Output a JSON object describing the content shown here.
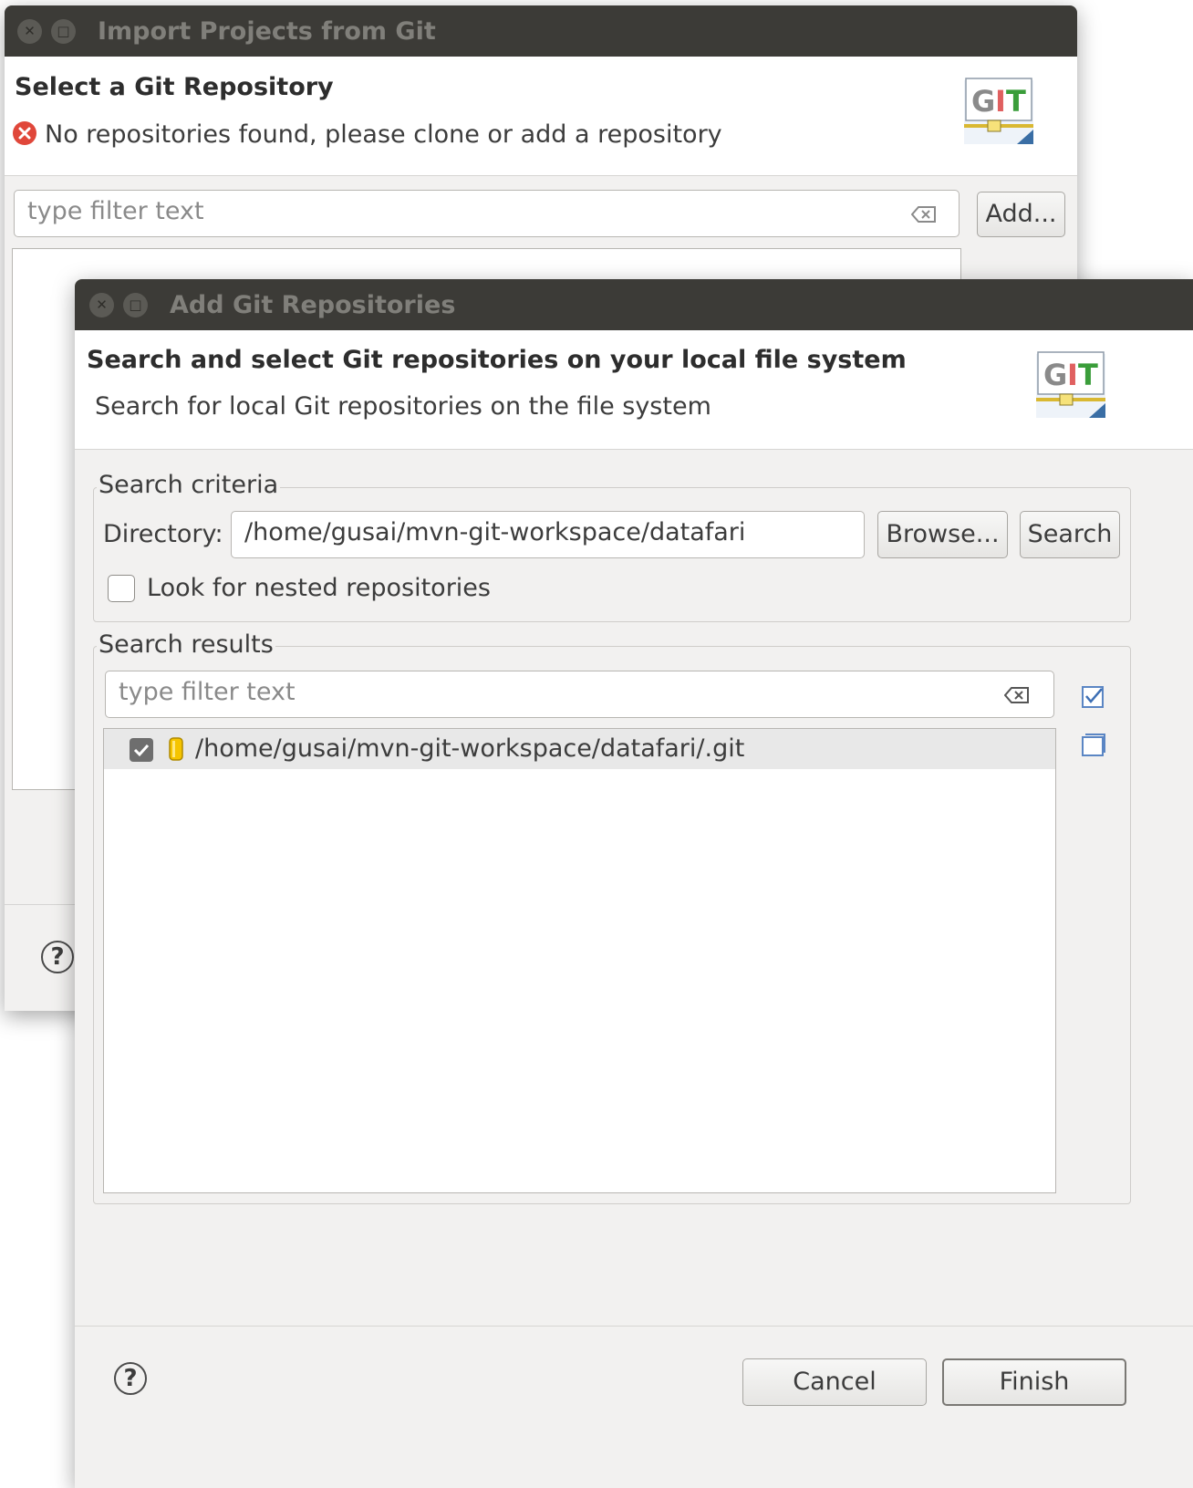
{
  "import_dialog": {
    "title": "Import Projects from Git",
    "heading": "Select a Git Repository",
    "message": "No repositories found, please clone or add a repository",
    "filter_placeholder": "type filter text",
    "add_button": "Add...",
    "help_icon": "help-icon"
  },
  "add_dialog": {
    "title": "Add Git Repositories",
    "heading": "Search and select Git repositories on your local file system",
    "subheading": "Search for local Git repositories on the file system",
    "search_criteria_label": "Search criteria",
    "directory_label": "Directory:",
    "directory_value": "/home/gusai/mvn-git-workspace/datafari",
    "browse_button": "Browse...",
    "search_button": "Search",
    "nested_checkbox_label": "Look for nested repositories",
    "nested_checked": false,
    "search_results_label": "Search results",
    "results_filter_placeholder": "type filter text",
    "results": [
      {
        "path": "/home/gusai/mvn-git-workspace/datafari/.git",
        "checked": true
      }
    ],
    "cancel_button": "Cancel",
    "finish_button": "Finish"
  },
  "logo_text": "GIT",
  "colors": {
    "titlebar": "#3c3b37",
    "error": "#e0473a",
    "git_green": "#3a9d3a",
    "repo_icon": "#f5c400"
  }
}
